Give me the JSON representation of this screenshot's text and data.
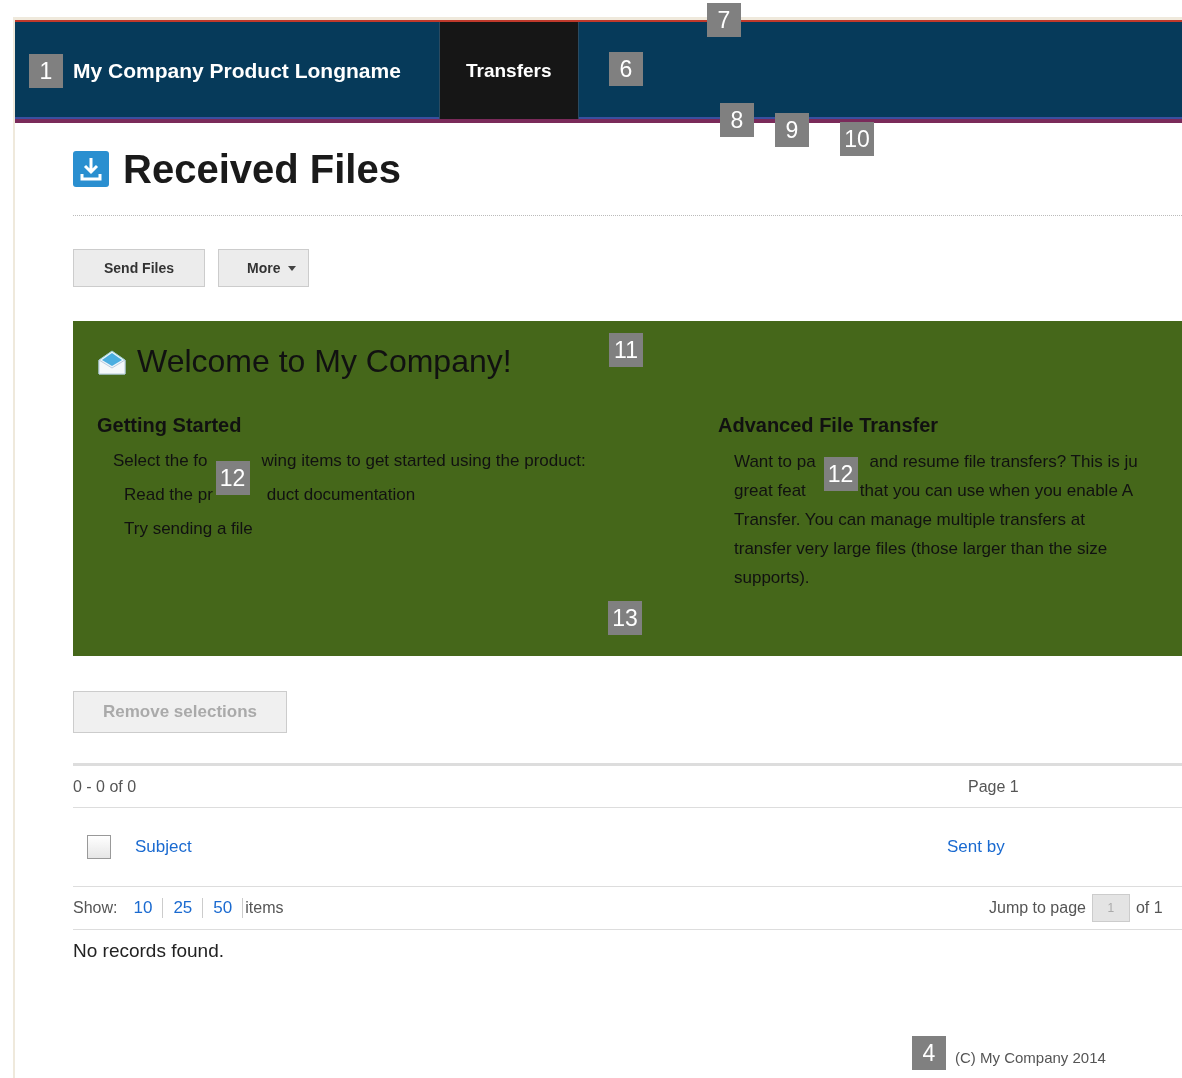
{
  "navbar": {
    "brand": "My Company Product Longname",
    "tabs": [
      {
        "label": "Transfers",
        "selected": true
      }
    ]
  },
  "page": {
    "title": "Received Files"
  },
  "toolbar": {
    "buttons": [
      {
        "label": "Send Files",
        "kind": "plain"
      },
      {
        "label": "More",
        "kind": "dropdown"
      }
    ]
  },
  "welcome": {
    "title": "Welcome to My Company!",
    "sections": [
      {
        "kind": "list",
        "heading": "Getting Started",
        "callout": "12",
        "intro": [
          "Select the fo",
          "wing items to get started using the product:"
        ],
        "items": [
          [
            "Read the pr",
            "duct documentation"
          ],
          [
            "Try sending a file"
          ]
        ]
      },
      {
        "kind": "paragraph",
        "heading": "Advanced File Transfer",
        "callout": "12",
        "lines": [
          [
            "Want to pa",
            "and resume file transfers? This is ju"
          ],
          [
            "great feat",
            "that you can use when you enable A"
          ],
          [
            "Transfer. You can manage multiple transfers at"
          ],
          [
            "transfer very large files (those larger than the size"
          ],
          [
            "supports)."
          ]
        ]
      }
    ]
  },
  "actions": {
    "remove": {
      "label": "Remove selections",
      "disabled": true
    }
  },
  "grid": {
    "range": "0 - 0 of 0",
    "page_label": "Page  1",
    "select_all": {
      "checked": false
    },
    "columns": [
      "Subject",
      "Sent by"
    ],
    "show_label": "Show:",
    "page_sizes": [
      "10",
      "25",
      "50"
    ],
    "items_label": "items",
    "jump_label": "Jump to page",
    "jump_value": "1",
    "of_label": "of 1",
    "empty": "No records found."
  },
  "footer": {
    "copyright": "(C) My Company 2014"
  },
  "callouts": [
    {
      "label": "1"
    },
    {
      "label": "6"
    },
    {
      "label": "7"
    },
    {
      "label": "8"
    },
    {
      "label": "9"
    },
    {
      "label": "10"
    },
    {
      "label": "11"
    },
    {
      "label": "13"
    },
    {
      "label": "4"
    }
  ]
}
